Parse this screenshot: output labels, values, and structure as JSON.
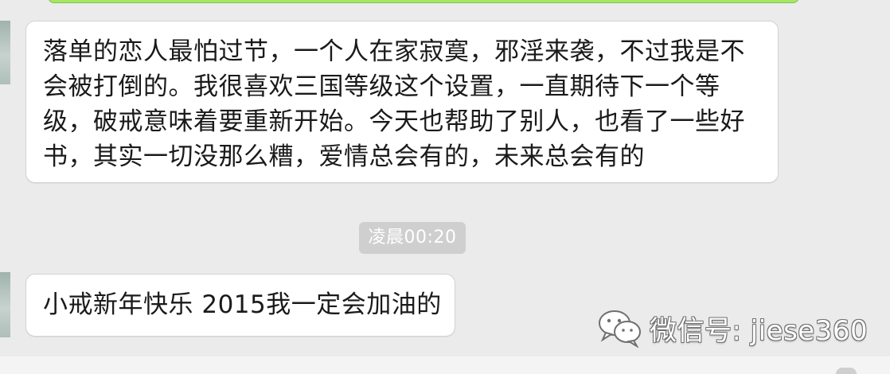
{
  "previous_message": {
    "kind": "outgoing-bubble-edge",
    "color": "#a6e860"
  },
  "messages": [
    {
      "direction": "incoming",
      "lines": [
        "落单的恋人最怕过节，一个人在家寂寞，邪淫来袭，不过我是不",
        "会被打倒的。我很喜欢三国等级这个设置，一直期待下一个等",
        "级，破戒意味着要重新开始。今天也帮助了别人，也看了一些好",
        "书，其实一切没那么糟，爱情总会有的，未来总会有的"
      ]
    },
    {
      "direction": "incoming",
      "lines": [
        "小戒新年快乐 2015我一定会加油的"
      ]
    }
  ],
  "timestamp": "凌晨00:20",
  "watermark": {
    "icon": "wechat-logo-icon",
    "text": "微信号: jiese360"
  },
  "colors": {
    "chat_background": "#ebebeb",
    "bubble_background": "#ffffff",
    "timestamp_background": "#cfcfcf",
    "outgoing_bubble": "#a6e860"
  }
}
